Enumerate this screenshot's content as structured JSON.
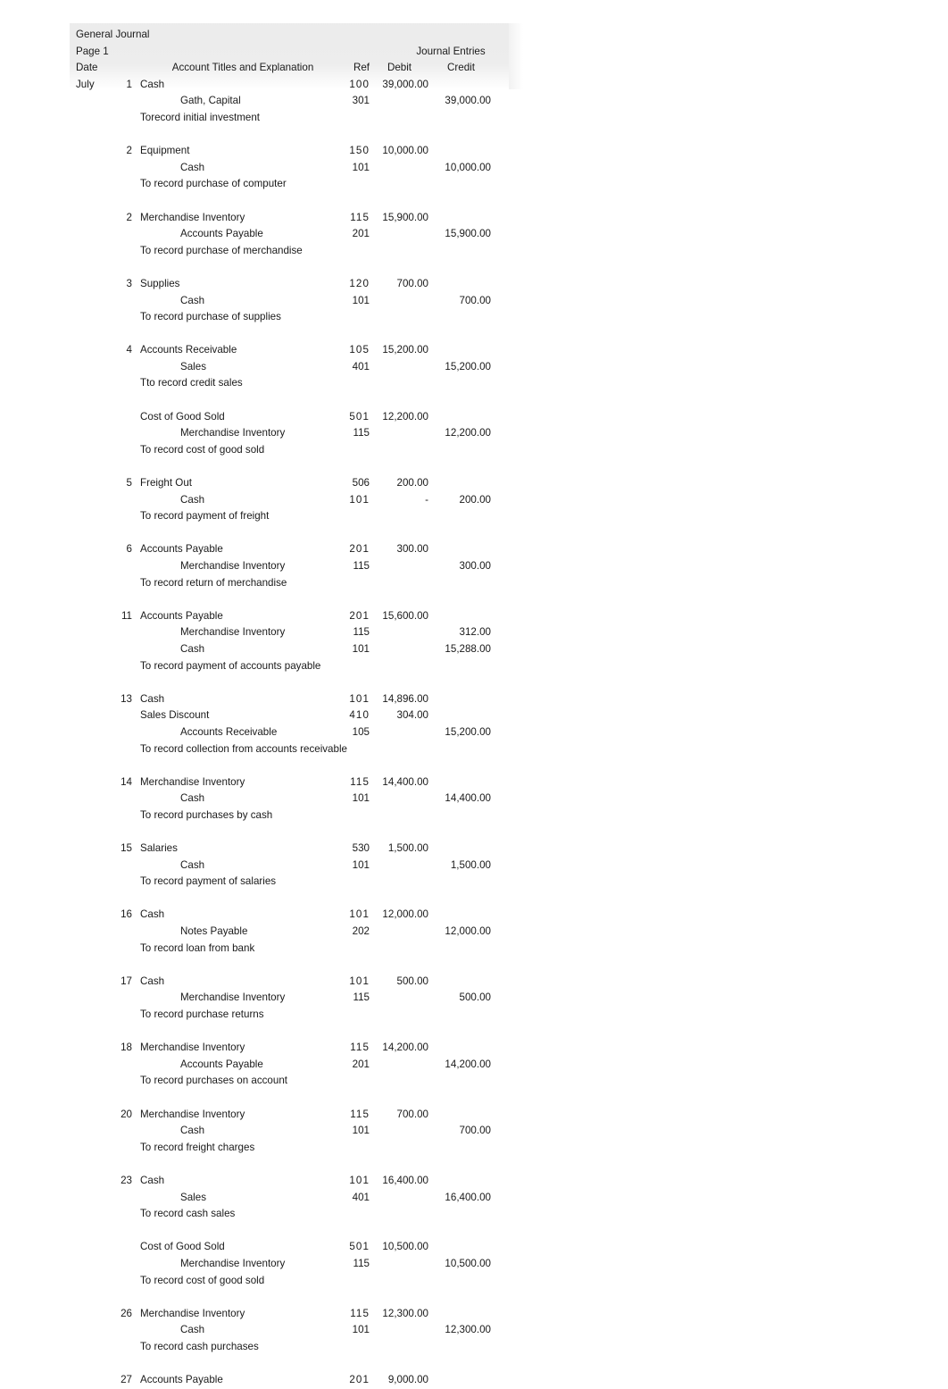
{
  "document": {
    "title": "General Journal",
    "page_label": "Page 1",
    "center_title": "Journal Entries"
  },
  "columns": {
    "date": "Date",
    "account": "Account Titles and Explanation",
    "ref": "Ref",
    "debit": "Debit",
    "credit": "Credit"
  },
  "month": "July",
  "entries": [
    {
      "day": "1",
      "month": "July",
      "lines": [
        {
          "kind": "debit",
          "account": "Cash",
          "ref": "100",
          "ref_wide": true,
          "debit": "39,000.00",
          "credit": ""
        },
        {
          "kind": "credit",
          "account": "Gath, Capital",
          "ref": "301",
          "ref_wide": false,
          "debit": "",
          "credit": "39,000.00"
        },
        {
          "kind": "explanation",
          "account": "Torecord initial investment",
          "ref": "",
          "debit": "",
          "credit": ""
        }
      ]
    },
    {
      "day": "2",
      "lines": [
        {
          "kind": "debit",
          "account": "Equipment",
          "ref": "150",
          "ref_wide": true,
          "debit": "10,000.00",
          "credit": ""
        },
        {
          "kind": "credit",
          "account": "Cash",
          "ref": "101",
          "ref_wide": false,
          "debit": "",
          "credit": "10,000.00"
        },
        {
          "kind": "explanation",
          "account": "To record purchase of computer",
          "ref": "",
          "debit": "",
          "credit": ""
        }
      ]
    },
    {
      "day": "2",
      "lines": [
        {
          "kind": "debit",
          "account": "Merchandise Inventory",
          "ref": "115",
          "ref_wide": true,
          "debit": "15,900.00",
          "credit": ""
        },
        {
          "kind": "credit",
          "account": "Accounts Payable",
          "ref": "201",
          "ref_wide": false,
          "debit": "",
          "credit": "15,900.00"
        },
        {
          "kind": "explanation",
          "account": "To record purchase of merchandise",
          "ref": "",
          "debit": "",
          "credit": ""
        }
      ]
    },
    {
      "day": "3",
      "lines": [
        {
          "kind": "debit",
          "account": "Supplies",
          "ref": "120",
          "ref_wide": true,
          "debit": "700.00",
          "credit": ""
        },
        {
          "kind": "credit",
          "account": "Cash",
          "ref": "101",
          "ref_wide": false,
          "debit": "",
          "credit": "700.00"
        },
        {
          "kind": "explanation",
          "account": "To record purchase of supplies",
          "ref": "",
          "debit": "",
          "credit": ""
        }
      ]
    },
    {
      "day": "4",
      "lines": [
        {
          "kind": "debit",
          "account": "Accounts Receivable",
          "ref": "105",
          "ref_wide": true,
          "debit": "15,200.00",
          "credit": ""
        },
        {
          "kind": "credit",
          "account": "Sales",
          "ref": "401",
          "ref_wide": false,
          "debit": "",
          "credit": "15,200.00"
        },
        {
          "kind": "explanation",
          "account": "Tto record credit sales",
          "ref": "",
          "debit": "",
          "credit": ""
        }
      ]
    },
    {
      "day": "",
      "lines": [
        {
          "kind": "debit",
          "account": "Cost of Good Sold",
          "ref": "501",
          "ref_wide": true,
          "debit": "12,200.00",
          "credit": ""
        },
        {
          "kind": "credit",
          "account": "Merchandise Inventory",
          "ref": "115",
          "ref_wide": false,
          "debit": "",
          "credit": "12,200.00"
        },
        {
          "kind": "explanation",
          "account": "To record cost of good sold",
          "ref": "",
          "debit": "",
          "credit": ""
        }
      ]
    },
    {
      "day": "5",
      "lines": [
        {
          "kind": "debit",
          "account": "Freight Out",
          "ref": "506",
          "ref_wide": false,
          "debit": "200.00",
          "credit": ""
        },
        {
          "kind": "credit",
          "account": "Cash",
          "ref": "101",
          "ref_wide": true,
          "debit": "-",
          "credit": "200.00"
        },
        {
          "kind": "explanation",
          "account": "To record payment of freight",
          "ref": "",
          "debit": "",
          "credit": ""
        }
      ]
    },
    {
      "day": "6",
      "lines": [
        {
          "kind": "debit",
          "account": "Accounts Payable",
          "ref": "201",
          "ref_wide": true,
          "debit": "300.00",
          "credit": ""
        },
        {
          "kind": "credit",
          "account": "Merchandise Inventory",
          "ref": "115",
          "ref_wide": false,
          "debit": "",
          "credit": "300.00"
        },
        {
          "kind": "explanation",
          "account": "To record return of merchandise",
          "ref": "",
          "debit": "",
          "credit": ""
        }
      ]
    },
    {
      "day": "11",
      "lines": [
        {
          "kind": "debit",
          "account": "Accounts Payable",
          "ref": "201",
          "ref_wide": true,
          "debit": "15,600.00",
          "credit": ""
        },
        {
          "kind": "credit",
          "account": "Merchandise Inventory",
          "ref": "115",
          "ref_wide": false,
          "debit": "",
          "credit": "312.00"
        },
        {
          "kind": "credit",
          "account": "Cash",
          "ref": "101",
          "ref_wide": false,
          "debit": "",
          "credit": "15,288.00"
        },
        {
          "kind": "explanation",
          "account": "To record payment of accounts payable",
          "ref": "",
          "debit": "",
          "credit": ""
        }
      ]
    },
    {
      "day": "13",
      "lines": [
        {
          "kind": "debit",
          "account": "Cash",
          "ref": "101",
          "ref_wide": true,
          "debit": "14,896.00",
          "credit": ""
        },
        {
          "kind": "debit",
          "account": "Sales Discount",
          "ref": "410",
          "ref_wide": true,
          "debit": "304.00",
          "credit": ""
        },
        {
          "kind": "credit",
          "account": "Accounts Receivable",
          "ref": "105",
          "ref_wide": false,
          "debit": "",
          "credit": "15,200.00"
        },
        {
          "kind": "explanation",
          "account": "To record collection from accounts receivable",
          "ref": "",
          "debit": "",
          "credit": ""
        }
      ]
    },
    {
      "day": "14",
      "lines": [
        {
          "kind": "debit",
          "account": "Merchandise Inventory",
          "ref": "115",
          "ref_wide": true,
          "debit": "14,400.00",
          "credit": ""
        },
        {
          "kind": "credit",
          "account": "Cash",
          "ref": "101",
          "ref_wide": false,
          "debit": "",
          "credit": "14,400.00"
        },
        {
          "kind": "explanation",
          "account": "To record purchases by cash",
          "ref": "",
          "debit": "",
          "credit": ""
        }
      ]
    },
    {
      "day": "15",
      "lines": [
        {
          "kind": "debit",
          "account": "Salaries",
          "ref": "530",
          "ref_wide": false,
          "debit": "1,500.00",
          "credit": ""
        },
        {
          "kind": "credit",
          "account": "Cash",
          "ref": "101",
          "ref_wide": false,
          "debit": "",
          "credit": "1,500.00"
        },
        {
          "kind": "explanation",
          "account": "To record payment of salaries",
          "ref": "",
          "debit": "",
          "credit": ""
        }
      ]
    },
    {
      "day": "16",
      "lines": [
        {
          "kind": "debit",
          "account": "Cash",
          "ref": "101",
          "ref_wide": true,
          "debit": "12,000.00",
          "credit": ""
        },
        {
          "kind": "credit",
          "account": "Notes Payable",
          "ref": "202",
          "ref_wide": false,
          "debit": "",
          "credit": "12,000.00"
        },
        {
          "kind": "explanation",
          "account": "To record loan from bank",
          "ref": "",
          "debit": "",
          "credit": ""
        }
      ]
    },
    {
      "day": "17",
      "lines": [
        {
          "kind": "debit",
          "account": "Cash",
          "ref": "101",
          "ref_wide": true,
          "debit": "500.00",
          "credit": ""
        },
        {
          "kind": "credit",
          "account": "Merchandise Inventory",
          "ref": "115",
          "ref_wide": false,
          "debit": "",
          "credit": "500.00"
        },
        {
          "kind": "explanation",
          "account": "To record purchase returns",
          "ref": "",
          "debit": "",
          "credit": ""
        }
      ]
    },
    {
      "day": "18",
      "lines": [
        {
          "kind": "debit",
          "account": "Merchandise Inventory",
          "ref": "115",
          "ref_wide": true,
          "debit": "14,200.00",
          "credit": ""
        },
        {
          "kind": "credit",
          "account": "Accounts Payable",
          "ref": "201",
          "ref_wide": false,
          "debit": "",
          "credit": "14,200.00"
        },
        {
          "kind": "explanation",
          "account": "To record purchases on account",
          "ref": "",
          "debit": "",
          "credit": ""
        }
      ]
    },
    {
      "day": "20",
      "lines": [
        {
          "kind": "debit",
          "account": "Merchandise Inventory",
          "ref": "115",
          "ref_wide": true,
          "debit": "700.00",
          "credit": ""
        },
        {
          "kind": "credit",
          "account": "Cash",
          "ref": "101",
          "ref_wide": false,
          "debit": "",
          "credit": "700.00"
        },
        {
          "kind": "explanation",
          "account": "To record freight charges",
          "ref": "",
          "debit": "",
          "credit": ""
        }
      ]
    },
    {
      "day": "23",
      "lines": [
        {
          "kind": "debit",
          "account": "Cash",
          "ref": "101",
          "ref_wide": true,
          "debit": "16,400.00",
          "credit": ""
        },
        {
          "kind": "credit",
          "account": "Sales",
          "ref": "401",
          "ref_wide": false,
          "debit": "",
          "credit": "16,400.00"
        },
        {
          "kind": "explanation",
          "account": "To record cash sales",
          "ref": "",
          "debit": "",
          "credit": ""
        }
      ]
    },
    {
      "day": "",
      "lines": [
        {
          "kind": "debit",
          "account": "Cost of Good Sold",
          "ref": "501",
          "ref_wide": true,
          "debit": "10,500.00",
          "credit": ""
        },
        {
          "kind": "credit",
          "account": "Merchandise Inventory",
          "ref": "115",
          "ref_wide": false,
          "debit": "",
          "credit": "10,500.00"
        },
        {
          "kind": "explanation",
          "account": "To record cost of good sold",
          "ref": "",
          "debit": "",
          "credit": ""
        }
      ]
    },
    {
      "day": "26",
      "lines": [
        {
          "kind": "debit",
          "account": "Merchandise Inventory",
          "ref": "115",
          "ref_wide": true,
          "debit": "12,300.00",
          "credit": ""
        },
        {
          "kind": "credit",
          "account": "Cash",
          "ref": "101",
          "ref_wide": false,
          "debit": "",
          "credit": "12,300.00"
        },
        {
          "kind": "explanation",
          "account": "To record cash purchases",
          "ref": "",
          "debit": "",
          "credit": ""
        }
      ]
    },
    {
      "day": "27",
      "lines": [
        {
          "kind": "debit",
          "account": "Accounts Payable",
          "ref": "201",
          "ref_wide": true,
          "debit": "9,000.00",
          "credit": ""
        }
      ]
    }
  ]
}
